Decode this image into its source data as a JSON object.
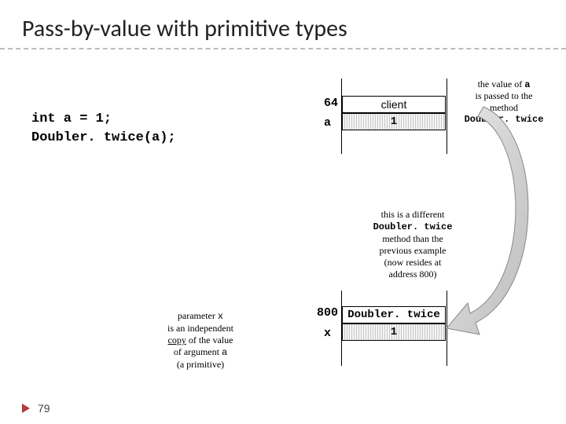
{
  "title": "Pass-by-value with primitive types",
  "code": {
    "line1": "int a = 1;",
    "line2": "Doubler. twice(a);"
  },
  "noteRight": {
    "l1": "the value of ",
    "l1b": "a",
    "l2": "is passed to the",
    "l3": "method",
    "l4": "Doubler. twice"
  },
  "table1": {
    "addr": "64",
    "var": "a",
    "header": "client",
    "value": "1"
  },
  "midNote": {
    "l1": "this is a different",
    "l2": "Doubler. twice",
    "l3": "method than the",
    "l4": "previous example",
    "l5": "(now resides at",
    "l6": "address 800)"
  },
  "table2": {
    "addr": "800",
    "var": "x",
    "header": "Doubler. twice",
    "value": "1"
  },
  "paramNote": {
    "l1a": "parameter ",
    "l1b": "x",
    "l2": "is an independent",
    "l3a": "copy",
    "l3b": " of the value",
    "l4a": "of argument ",
    "l4b": "a",
    "l5": "(a primitive)"
  },
  "slideNumber": "79"
}
